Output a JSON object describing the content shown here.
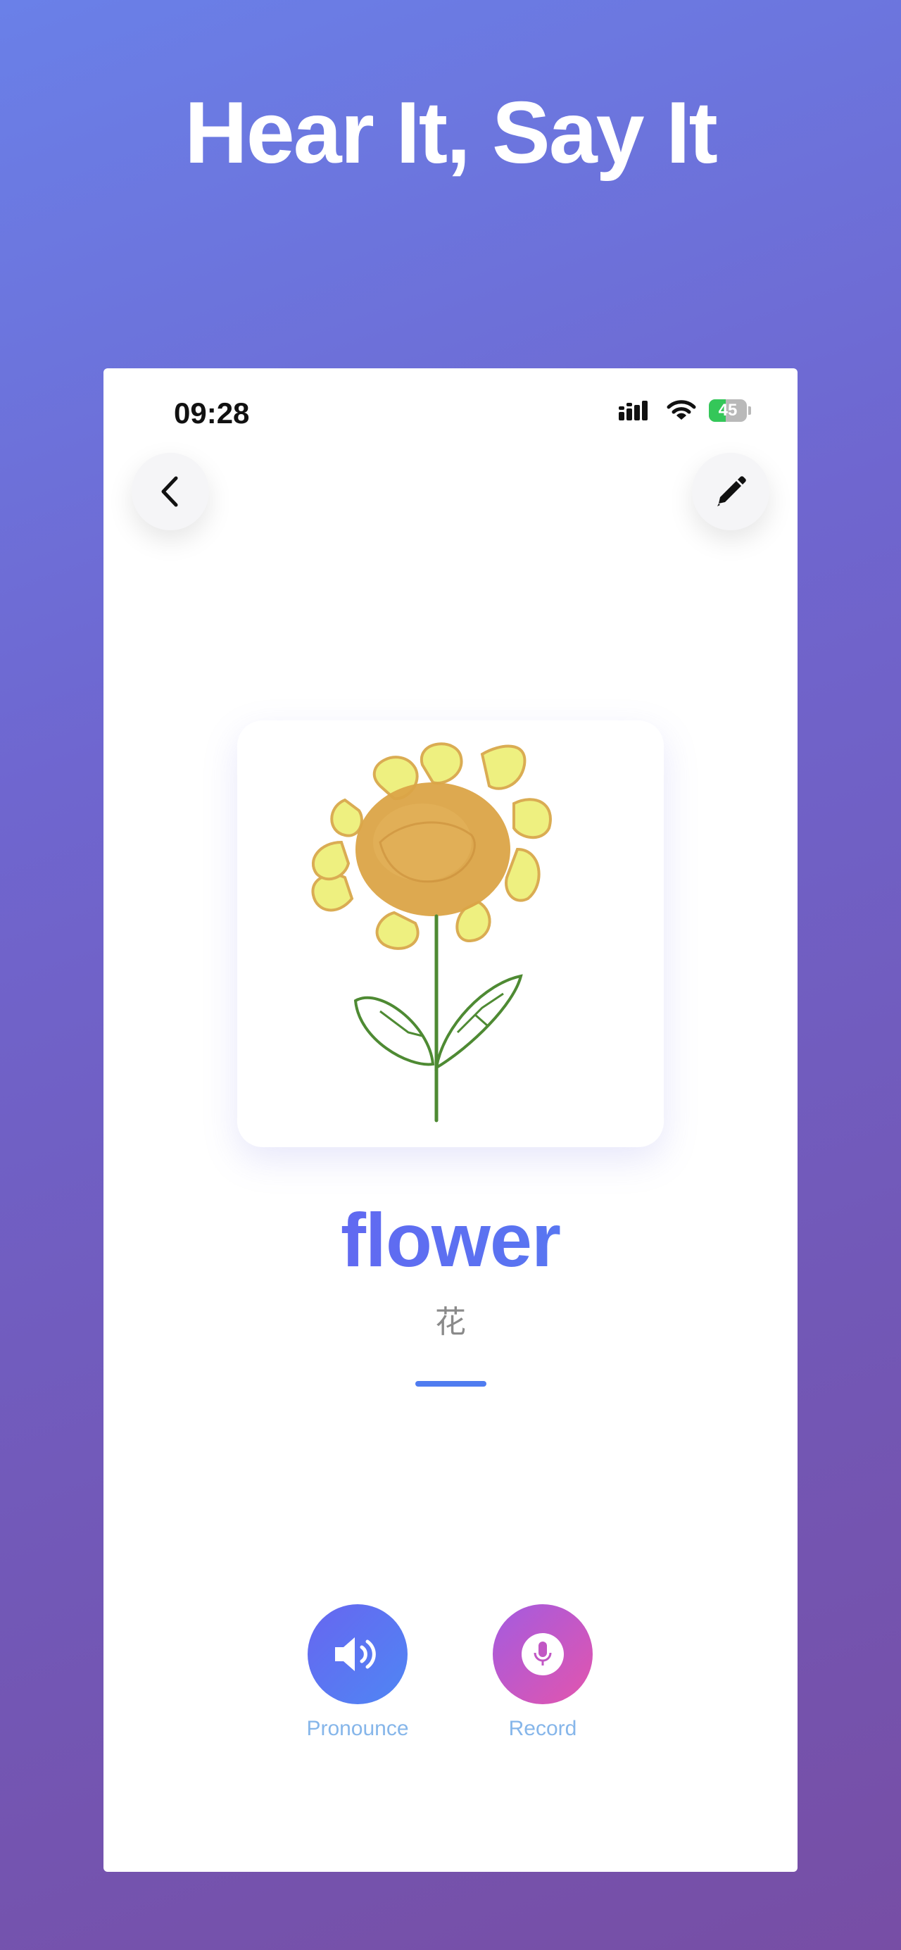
{
  "headline": "Hear It, Say It",
  "status_bar": {
    "time": "09:28",
    "battery_level": 45,
    "battery_text": "45"
  },
  "nav": {
    "back_icon": "chevron-left-icon",
    "edit_icon": "pencil-icon"
  },
  "card": {
    "word": "flower",
    "translation": "花",
    "image": "sunflower-drawing"
  },
  "actions": {
    "pronounce_label": "Pronounce",
    "record_label": "Record"
  },
  "colors": {
    "accent_blue": "#4f7cf0",
    "accent_purple": "#6a5cf0",
    "record_pink": "#e355ad",
    "battery_green": "#34c759",
    "label_blue": "#86b6ea"
  }
}
